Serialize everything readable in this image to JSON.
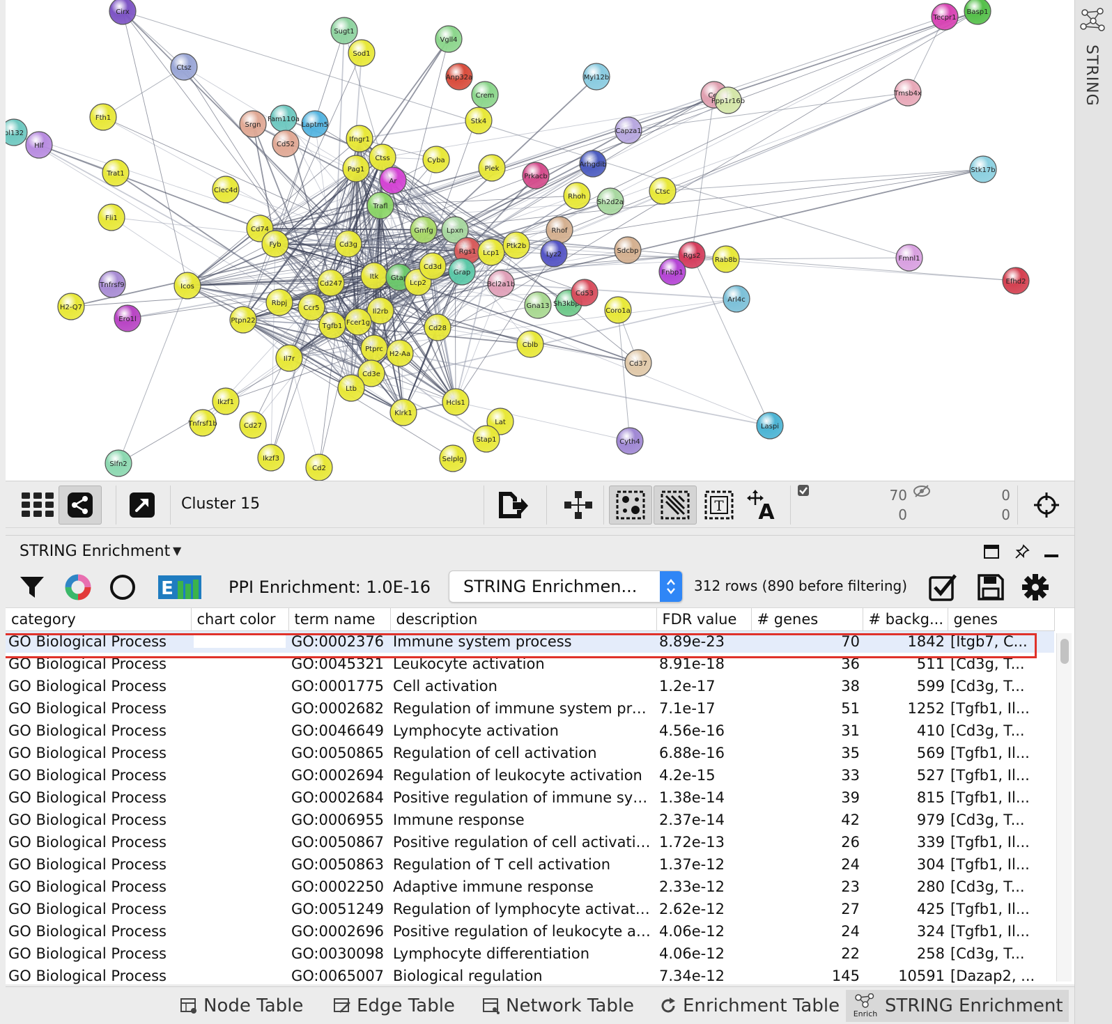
{
  "side_panel": {
    "tab_label": "STRING"
  },
  "network": {
    "nodes": [
      {
        "label": "Cirx",
        "color": "#7d54c4"
      },
      {
        "label": "Sugt1",
        "color": "#8fd3a0"
      },
      {
        "label": "Vgll4",
        "color": "#8cd68c"
      },
      {
        "label": "Tecpr1",
        "color": "#d844b4"
      },
      {
        "label": "Basp1",
        "color": "#55c04a"
      },
      {
        "label": "Ctsz",
        "color": "#9aa6d6"
      },
      {
        "label": "Sod1",
        "color": "#e8e838"
      },
      {
        "label": "Anp32a",
        "color": "#d84c3c"
      },
      {
        "label": "Myl12b",
        "color": "#8acbe0"
      },
      {
        "label": "Crem",
        "color": "#8cd68c"
      },
      {
        "label": "Cer",
        "color": "#e0a0b0"
      },
      {
        "label": "Ppp1r16b",
        "color": "#d4e6a8"
      },
      {
        "label": "Tmsb4x",
        "color": "#e8a8b8"
      },
      {
        "label": "Fth1",
        "color": "#e8e838"
      },
      {
        "label": "Srgn",
        "color": "#e0a894"
      },
      {
        "label": "Fam110a",
        "color": "#6ec8c0"
      },
      {
        "label": "Laptm5",
        "color": "#54b4e0"
      },
      {
        "label": "Stk4",
        "color": "#e8e838"
      },
      {
        "label": "Capza1",
        "color": "#b8a8e0"
      },
      {
        "label": "pl132",
        "color": "#6ec8c0"
      },
      {
        "label": "Hlf",
        "color": "#b88ce0"
      },
      {
        "label": "Cd52",
        "color": "#e0a894"
      },
      {
        "label": "Ifngr1",
        "color": "#e8e838"
      },
      {
        "label": "Ctss",
        "color": "#e8e838"
      },
      {
        "label": "Cyba",
        "color": "#e8e838"
      },
      {
        "label": "Arhgdib",
        "color": "#4c5cc0"
      },
      {
        "label": "Trat1",
        "color": "#e8e838"
      },
      {
        "label": "Pag1",
        "color": "#e8e838"
      },
      {
        "label": "Ar",
        "color": "#d444d4"
      },
      {
        "label": "Plek",
        "color": "#e8e838"
      },
      {
        "label": "Prkacb",
        "color": "#d44c8c"
      },
      {
        "label": "Stk17b",
        "color": "#8cd0e0"
      },
      {
        "label": "Clec4d",
        "color": "#e8e838"
      },
      {
        "label": "Trafl",
        "color": "#8cd668"
      },
      {
        "label": "Rhoh",
        "color": "#e8e838"
      },
      {
        "label": "Sh2d2a",
        "color": "#a8d8a0"
      },
      {
        "label": "Ctsc",
        "color": "#e8e838"
      },
      {
        "label": "Fli1",
        "color": "#e8e838"
      },
      {
        "label": "Cd74",
        "color": "#e8e838"
      },
      {
        "label": "Gmfg",
        "color": "#a8d868"
      },
      {
        "label": "Lpxn",
        "color": "#a8d8a0"
      },
      {
        "label": "Rhof",
        "color": "#d4b090"
      },
      {
        "label": "Fyb",
        "color": "#e8e838"
      },
      {
        "label": "Cd3g",
        "color": "#e8e838"
      },
      {
        "label": "Rgs1",
        "color": "#d85c5c"
      },
      {
        "label": "Lcp1",
        "color": "#e8e838"
      },
      {
        "label": "Ptk2b",
        "color": "#e8e838"
      },
      {
        "label": "Sdcbp",
        "color": "#d4b090"
      },
      {
        "label": "Rgs2",
        "color": "#d43c5c"
      },
      {
        "label": "Rab8b",
        "color": "#e8e838"
      },
      {
        "label": "Fmnl1",
        "color": "#d8a0e0"
      },
      {
        "label": "Lyz2",
        "color": "#5454c4"
      },
      {
        "label": "Fnbp1",
        "color": "#b444d4"
      },
      {
        "label": "Tnfrsf9",
        "color": "#a88cd4"
      },
      {
        "label": "Itk",
        "color": "#e8e838"
      },
      {
        "label": "Cd247",
        "color": "#e8e838"
      },
      {
        "label": "Gtap",
        "color": "#6cc86c"
      },
      {
        "label": "Lcp2",
        "color": "#e8e838"
      },
      {
        "label": "Cd3d",
        "color": "#e8e838"
      },
      {
        "label": "Grap",
        "color": "#5cc8a8"
      },
      {
        "label": "Bcl2a1b",
        "color": "#e0a0b8"
      },
      {
        "label": "Efhd2",
        "color": "#d44050"
      },
      {
        "label": "Icos",
        "color": "#e8e838"
      },
      {
        "label": "H2-Q7",
        "color": "#e8e838"
      },
      {
        "label": "Rbpj",
        "color": "#e8e838"
      },
      {
        "label": "Ccr5",
        "color": "#e8e838"
      },
      {
        "label": "Il2rb",
        "color": "#e8e838"
      },
      {
        "label": "Gna13",
        "color": "#a8d890"
      },
      {
        "label": "Sh3kbp1",
        "color": "#6cc888"
      },
      {
        "label": "Cd53",
        "color": "#d84c5c"
      },
      {
        "label": "Coro1a",
        "color": "#e8e838"
      },
      {
        "label": "Arl4c",
        "color": "#7cc0d8"
      },
      {
        "label": "Ero1l",
        "color": "#b844c4"
      },
      {
        "label": "Ptpn22",
        "color": "#e8e838"
      },
      {
        "label": "Tgfb1",
        "color": "#e8e838"
      },
      {
        "label": "Fcer1g",
        "color": "#e8e838"
      },
      {
        "label": "Cd28",
        "color": "#e8e838"
      },
      {
        "label": "Cblb",
        "color": "#e8e838"
      },
      {
        "label": "Ptprc",
        "color": "#e8e838"
      },
      {
        "label": "H2-Aa",
        "color": "#e8e838"
      },
      {
        "label": "Il7r",
        "color": "#e8e838"
      },
      {
        "label": "Cd37",
        "color": "#e0c8a8"
      },
      {
        "label": "Cd3e",
        "color": "#e8e838"
      },
      {
        "label": "Ltb",
        "color": "#e8e838"
      },
      {
        "label": "Ikzf1",
        "color": "#e8e838"
      },
      {
        "label": "Klrk1",
        "color": "#e8e838"
      },
      {
        "label": "Hcls1",
        "color": "#e8e838"
      },
      {
        "label": "Lat",
        "color": "#e8e838"
      },
      {
        "label": "Laspi",
        "color": "#4cb4d4"
      },
      {
        "label": "Tnfrsf1b",
        "color": "#e8e838"
      },
      {
        "label": "Cd27",
        "color": "#e8e838"
      },
      {
        "label": "Stap1",
        "color": "#e8e838"
      },
      {
        "label": "Cyth4",
        "color": "#a088d4"
      },
      {
        "label": "Ikzf3",
        "color": "#e8e838"
      },
      {
        "label": "Selplg",
        "color": "#e8e838"
      },
      {
        "label": "Slfn2",
        "color": "#8cd8b0"
      },
      {
        "label": "Cd2",
        "color": "#e8e838"
      }
    ]
  },
  "network_toolbar": {
    "grid_icon": "grid-icon",
    "share_icon": "share-network-icon",
    "open_icon": "open-external-icon",
    "network_name": "Cluster 15",
    "selected_nodes": "70",
    "selected_edges": "0",
    "hidden_nodes": "0",
    "hidden_edges": "0"
  },
  "enrichment_panel": {
    "title": "STRING Enrichment",
    "ppi_label": "PPI Enrichment: 1.0E-16",
    "select_value": "STRING Enrichmen...",
    "rows_info": "312 rows (890 before filtering)",
    "columns": [
      "category",
      "chart color",
      "term name",
      "description",
      "FDR value",
      "# genes",
      "# backg...",
      "genes"
    ],
    "rows": [
      [
        "GO Biological Process",
        "",
        "GO:0002376",
        "Immune system process",
        "8.89e-23",
        "70",
        "1842",
        "[Itgb7, C..."
      ],
      [
        "GO Biological Process",
        "",
        "GO:0045321",
        "Leukocyte activation",
        "8.91e-18",
        "36",
        "511",
        "[Cd3g, T..."
      ],
      [
        "GO Biological Process",
        "",
        "GO:0001775",
        "Cell activation",
        "1.2e-17",
        "38",
        "599",
        "[Cd3g, T..."
      ],
      [
        "GO Biological Process",
        "",
        "GO:0002682",
        "Regulation of immune system pro...",
        "7.1e-17",
        "51",
        "1252",
        "[Tgfb1, Il..."
      ],
      [
        "GO Biological Process",
        "",
        "GO:0046649",
        "Lymphocyte activation",
        "4.56e-16",
        "31",
        "410",
        "[Cd3g, T..."
      ],
      [
        "GO Biological Process",
        "",
        "GO:0050865",
        "Regulation of cell activation",
        "6.88e-16",
        "35",
        "569",
        "[Tgfb1, Il..."
      ],
      [
        "GO Biological Process",
        "",
        "GO:0002694",
        "Regulation of leukocyte activation",
        "4.2e-15",
        "33",
        "527",
        "[Tgfb1, Il..."
      ],
      [
        "GO Biological Process",
        "",
        "GO:0002684",
        "Positive regulation of immune sys...",
        "1.38e-14",
        "39",
        "815",
        "[Tgfb1, Il..."
      ],
      [
        "GO Biological Process",
        "",
        "GO:0006955",
        "Immune response",
        "2.37e-14",
        "42",
        "979",
        "[Cd3g, T..."
      ],
      [
        "GO Biological Process",
        "",
        "GO:0050867",
        "Positive regulation of cell activation",
        "1.72e-13",
        "26",
        "339",
        "[Tgfb1, Il..."
      ],
      [
        "GO Biological Process",
        "",
        "GO:0050863",
        "Regulation of T cell activation",
        "1.37e-12",
        "24",
        "304",
        "[Tgfb1, Il..."
      ],
      [
        "GO Biological Process",
        "",
        "GO:0002250",
        "Adaptive immune response",
        "2.33e-12",
        "23",
        "280",
        "[Cd3g, T..."
      ],
      [
        "GO Biological Process",
        "",
        "GO:0051249",
        "Regulation of lymphocyte activation",
        "2.62e-12",
        "27",
        "425",
        "[Tgfb1, Il..."
      ],
      [
        "GO Biological Process",
        "",
        "GO:0002696",
        "Positive regulation of leukocyte ac...",
        "4.06e-12",
        "24",
        "324",
        "[Tgfb1, Il..."
      ],
      [
        "GO Biological Process",
        "",
        "GO:0030098",
        "Lymphocyte differentiation",
        "4.06e-12",
        "22",
        "258",
        "[Cd3g, T..."
      ],
      [
        "GO Biological Process",
        "",
        "GO:0065007",
        "Biological regulation",
        "7.34e-12",
        "145",
        "10591",
        "[Dazap2, ..."
      ]
    ]
  },
  "bottom_tabs": [
    {
      "label": "Node Table",
      "icon": "table-icon"
    },
    {
      "label": "Edge Table",
      "icon": "table-edit-icon"
    },
    {
      "label": "Network Table",
      "icon": "table-network-icon"
    },
    {
      "label": "Enrichment Table",
      "icon": "refresh-icon"
    },
    {
      "label": "STRING Enrichment",
      "icon": "enrich-network-icon",
      "active": true
    }
  ],
  "colors": {
    "highlight": "#e0322a",
    "select_accent": "#2f86f6",
    "selected_row": "#e4ecfa"
  }
}
